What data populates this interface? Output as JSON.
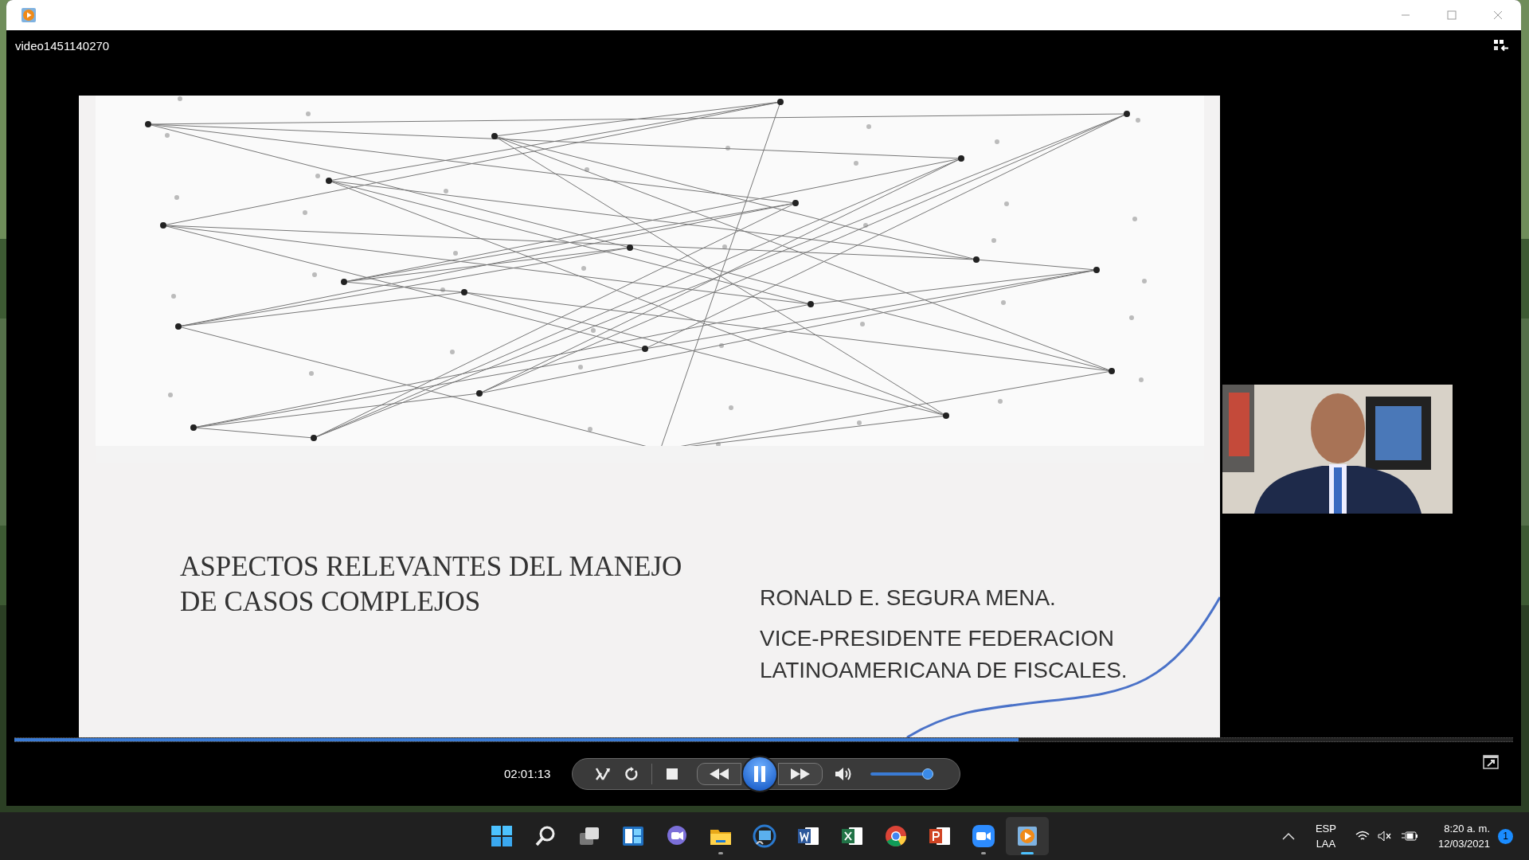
{
  "window": {
    "title": "video1451140270"
  },
  "slide": {
    "title": "ASPECTOS RELEVANTES DEL MANEJO DE CASOS COMPLEJOS",
    "presenter": "RONALD E. SEGURA MENA.",
    "role": "VICE-PRESIDENTE FEDERACION LATINOAMERICANA DE FISCALES."
  },
  "player": {
    "elapsed": "02:01:13",
    "seek": {
      "level": 0.67
    },
    "playing": true,
    "volume": {
      "level": 0.95
    }
  },
  "taskbar": {
    "apps": [
      {
        "kind": "start",
        "running": false,
        "active": false
      },
      {
        "kind": "search",
        "running": false,
        "active": false
      },
      {
        "kind": "taskview",
        "running": false,
        "active": false
      },
      {
        "kind": "widgets",
        "running": false,
        "active": false
      },
      {
        "kind": "chat",
        "running": false,
        "active": false
      },
      {
        "kind": "explorer",
        "running": true,
        "active": false
      },
      {
        "kind": "cast",
        "running": false,
        "active": false
      },
      {
        "kind": "word",
        "running": false,
        "active": false
      },
      {
        "kind": "excel",
        "running": false,
        "active": false
      },
      {
        "kind": "chrome",
        "running": false,
        "active": false
      },
      {
        "kind": "powerpoint",
        "running": false,
        "active": false
      },
      {
        "kind": "zoom",
        "running": true,
        "active": false
      },
      {
        "kind": "mediaplayer",
        "running": true,
        "active": true
      }
    ],
    "tray": {
      "language": "ESP",
      "layout": "LAA",
      "time": "8:20 a. m.",
      "date": "12/03/2021",
      "notifications": "1"
    }
  }
}
